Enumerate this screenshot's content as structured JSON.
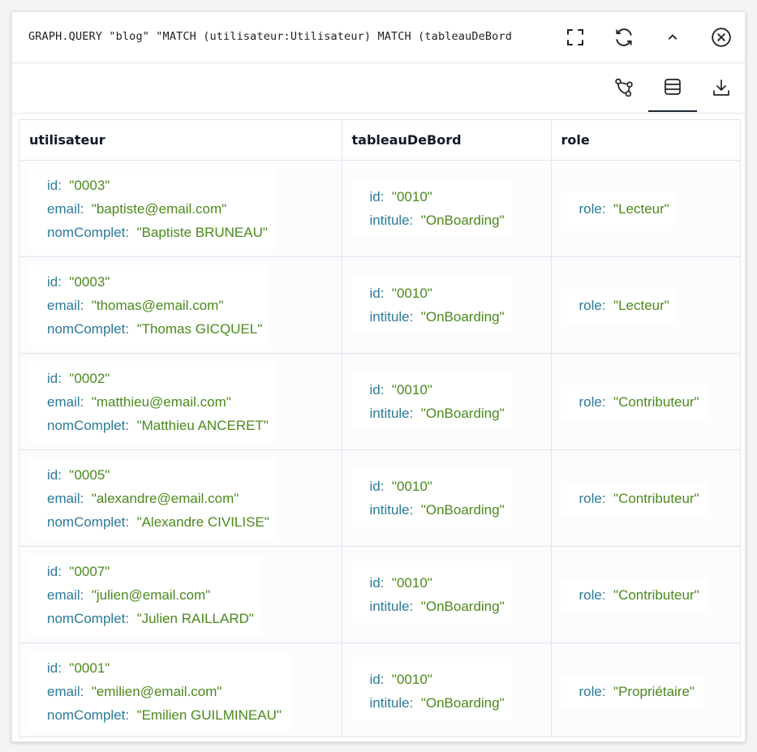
{
  "header": {
    "query": "GRAPH.QUERY \"blog\" \"MATCH (utilisateur:Utilisateur) MATCH (tableauDeBord",
    "icons": [
      "fullscreen-icon",
      "refresh-icon",
      "chevron-up-icon",
      "close-icon"
    ]
  },
  "toolbar": {
    "icons": [
      "graph-view-icon",
      "table-view-icon",
      "download-icon"
    ],
    "active": "table-view-icon"
  },
  "colors": {
    "key": "#2b7a9b",
    "value": "#4a8a1c",
    "text": "#111827"
  },
  "table": {
    "columns": [
      "utilisateur",
      "tableauDeBord",
      "role"
    ],
    "rows": [
      {
        "utilisateur": [
          {
            "k": "id:",
            "v": "\"0003\""
          },
          {
            "k": "email:",
            "v": "\"baptiste@email.com\""
          },
          {
            "k": "nomComplet:",
            "v": "\"Baptiste BRUNEAU\""
          }
        ],
        "tableauDeBord": [
          {
            "k": "id:",
            "v": "\"0010\""
          },
          {
            "k": "intitule:",
            "v": "\"OnBoarding\""
          }
        ],
        "role": [
          {
            "k": "role:",
            "v": "\"Lecteur\""
          }
        ]
      },
      {
        "utilisateur": [
          {
            "k": "id:",
            "v": "\"0003\""
          },
          {
            "k": "email:",
            "v": "\"thomas@email.com\""
          },
          {
            "k": "nomComplet:",
            "v": "\"Thomas GICQUEL\""
          }
        ],
        "tableauDeBord": [
          {
            "k": "id:",
            "v": "\"0010\""
          },
          {
            "k": "intitule:",
            "v": "\"OnBoarding\""
          }
        ],
        "role": [
          {
            "k": "role:",
            "v": "\"Lecteur\""
          }
        ]
      },
      {
        "utilisateur": [
          {
            "k": "id:",
            "v": "\"0002\""
          },
          {
            "k": "email:",
            "v": "\"matthieu@email.com\""
          },
          {
            "k": "nomComplet:",
            "v": "\"Matthieu ANCERET\""
          }
        ],
        "tableauDeBord": [
          {
            "k": "id:",
            "v": "\"0010\""
          },
          {
            "k": "intitule:",
            "v": "\"OnBoarding\""
          }
        ],
        "role": [
          {
            "k": "role:",
            "v": "\"Contributeur\""
          }
        ]
      },
      {
        "utilisateur": [
          {
            "k": "id:",
            "v": "\"0005\""
          },
          {
            "k": "email:",
            "v": "\"alexandre@email.com\""
          },
          {
            "k": "nomComplet:",
            "v": "\"Alexandre CIVILISE\""
          }
        ],
        "tableauDeBord": [
          {
            "k": "id:",
            "v": "\"0010\""
          },
          {
            "k": "intitule:",
            "v": "\"OnBoarding\""
          }
        ],
        "role": [
          {
            "k": "role:",
            "v": "\"Contributeur\""
          }
        ]
      },
      {
        "utilisateur": [
          {
            "k": "id:",
            "v": "\"0007\""
          },
          {
            "k": "email:",
            "v": "\"julien@email.com\""
          },
          {
            "k": "nomComplet:",
            "v": "\"Julien RAILLARD\""
          }
        ],
        "tableauDeBord": [
          {
            "k": "id:",
            "v": "\"0010\""
          },
          {
            "k": "intitule:",
            "v": "\"OnBoarding\""
          }
        ],
        "role": [
          {
            "k": "role:",
            "v": "\"Contributeur\""
          }
        ]
      },
      {
        "utilisateur": [
          {
            "k": "id:",
            "v": "\"0001\""
          },
          {
            "k": "email:",
            "v": "\"emilien@email.com\""
          },
          {
            "k": "nomComplet:",
            "v": "\"Emilien GUILMINEAU\""
          }
        ],
        "tableauDeBord": [
          {
            "k": "id:",
            "v": "\"0010\""
          },
          {
            "k": "intitule:",
            "v": "\"OnBoarding\""
          }
        ],
        "role": [
          {
            "k": "role:",
            "v": "\"Propriétaire\""
          }
        ]
      }
    ]
  }
}
